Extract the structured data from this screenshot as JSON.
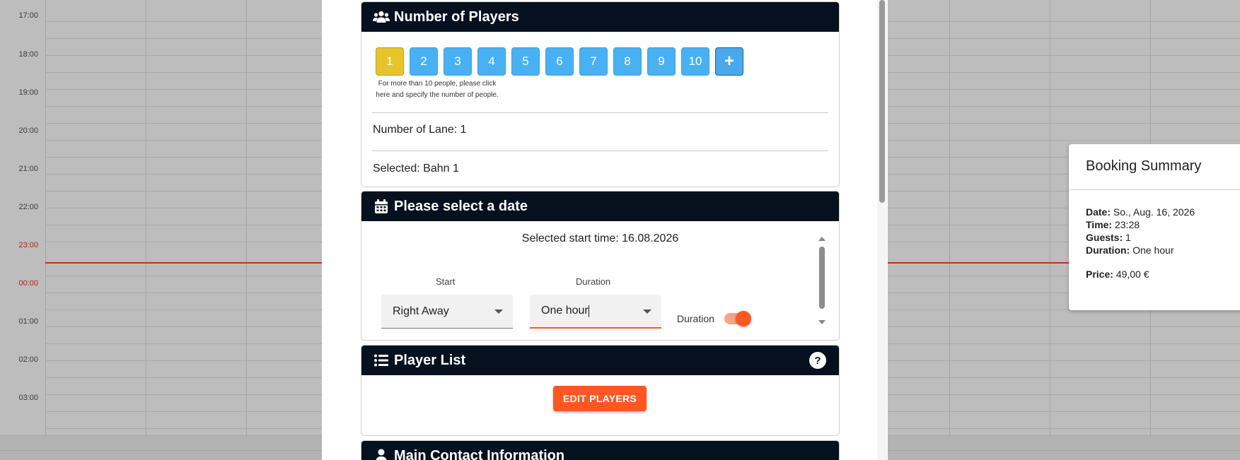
{
  "calendar": {
    "times": [
      "17:00",
      "18:00",
      "19:00",
      "20:00",
      "21:00",
      "22:00",
      "23:00",
      "00:00",
      "01:00",
      "02:00",
      "03:00"
    ],
    "current_time_color": "#c3311f"
  },
  "players": {
    "title": "Number of Players",
    "options": [
      "1",
      "2",
      "3",
      "4",
      "5",
      "6",
      "7",
      "8",
      "9",
      "10"
    ],
    "selected": "1",
    "plus_label": "+",
    "note": "For more than 10 people, please click here and specify the number of people.",
    "lane_text": "Number of Lane: 1",
    "selected_text": "Selected: Bahn 1"
  },
  "date": {
    "title": "Please select a date",
    "selected_start": "Selected start time: 16.08.2026",
    "start_label": "Start",
    "start_value": "Right Away",
    "duration_label": "Duration",
    "duration_value": "One hour",
    "toggle_label": "Duration",
    "toggle_on": true
  },
  "player_list": {
    "title": "Player List",
    "help_label": "?",
    "edit_button": "EDIT PLAYERS"
  },
  "contact": {
    "title": "Main Contact Information"
  },
  "summary": {
    "title": "Booking Summary",
    "date_label": "Date:",
    "date_value": "So., Aug. 16, 2026",
    "time_label": "Time:",
    "time_value": "23:28",
    "guests_label": "Guests:",
    "guests_value": "1",
    "duration_label": "Duration:",
    "duration_value": "One hour",
    "price_label": "Price:",
    "price_value": "49,00 €"
  },
  "colors": {
    "header_bg": "#06111f",
    "accent": "#ff5722",
    "player_btn": "#47b1f3",
    "player_selected": "#e7c52a"
  }
}
